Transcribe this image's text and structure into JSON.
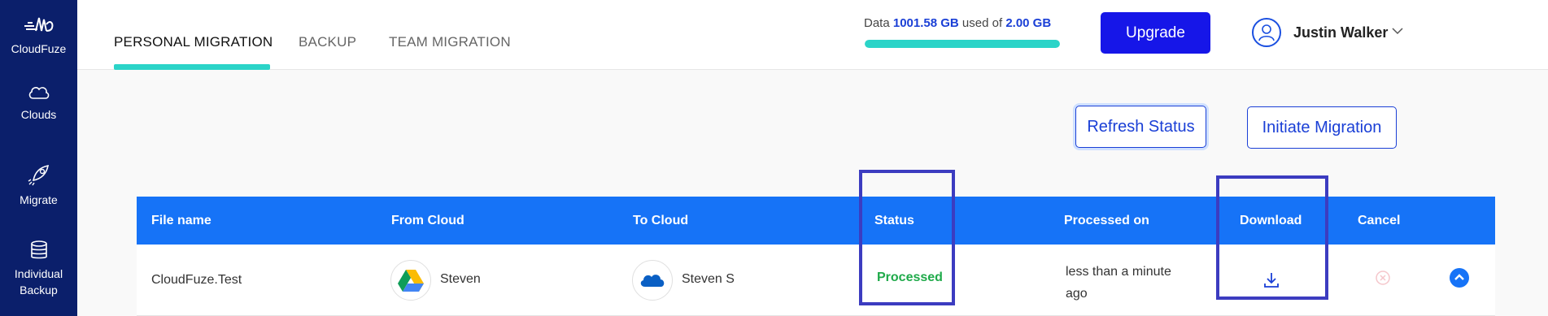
{
  "sidebar": {
    "brand": "CloudFuze",
    "items": [
      {
        "label": "Clouds",
        "icon": "cloud-icon"
      },
      {
        "label": "Migrate",
        "icon": "rocket-icon"
      },
      {
        "label": "Individual Backup",
        "icon": "database-icon"
      }
    ]
  },
  "header": {
    "tabs": [
      {
        "label": "PERSONAL MIGRATION",
        "active": true
      },
      {
        "label": "BACKUP",
        "active": false
      },
      {
        "label": "TEAM MIGRATION",
        "active": false
      }
    ],
    "storage": {
      "prefix": "Data",
      "used": "1001.58 GB",
      "middle": "used of",
      "total": "2.00 GB",
      "fill_fraction": 1.0
    },
    "upgrade_label": "Upgrade",
    "user_name": "Justin Walker"
  },
  "actions": {
    "refresh_label": "Refresh Status",
    "initiate_label": "Initiate Migration"
  },
  "table": {
    "columns": [
      "File name",
      "From Cloud",
      "To Cloud",
      "Status",
      "Processed on",
      "Download",
      "Cancel"
    ],
    "rows": [
      {
        "file_name": "CloudFuze.Test",
        "from_cloud": "Steven",
        "from_icon": "google-drive-icon",
        "to_cloud": "Steven S",
        "to_icon": "onedrive-icon",
        "status": "Processed",
        "processed_on": "less than a minute ago"
      }
    ]
  },
  "colors": {
    "sidebar": "#0b1f6b",
    "accent": "#2bd4c8",
    "primary": "#1616e8",
    "table_header": "#1673f7",
    "status_green": "#1faa4a",
    "highlight": "#3c3cc0"
  }
}
